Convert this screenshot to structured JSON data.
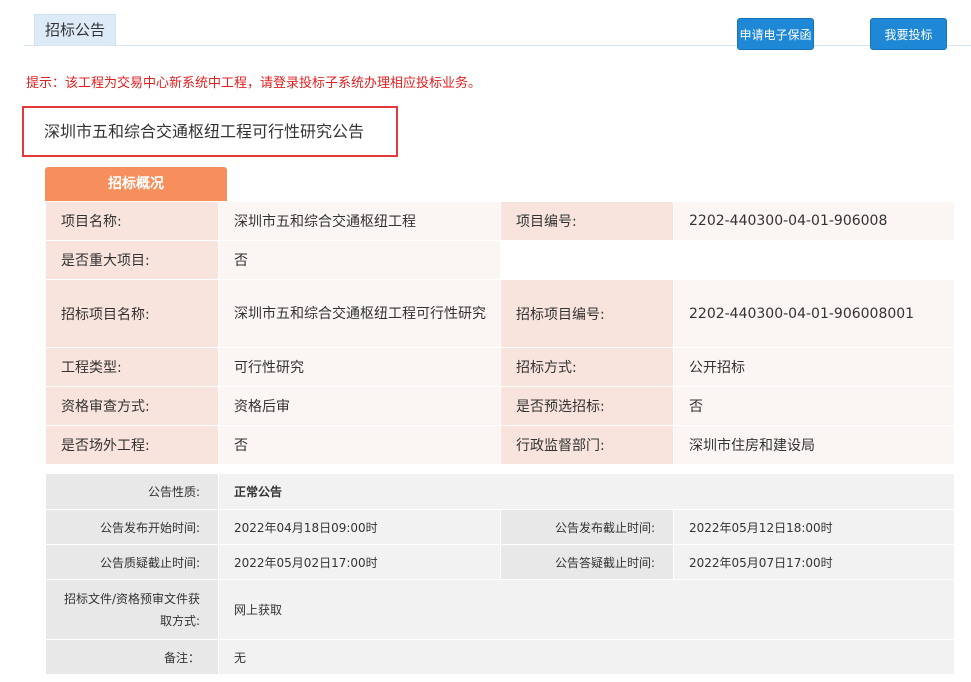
{
  "header": {
    "tab_label": "招标公告",
    "apply_guarantee_button": "申请电子保函",
    "bid_button": "我要投标"
  },
  "notice": "提示：该工程为交易中心新系统中工程，请登录投标子系统办理相应投标业务。",
  "project_title": "深圳市五和综合交通枢纽工程可行性研究公告",
  "overview": {
    "section_label": "招标概况",
    "project_name_label": "项目名称:",
    "project_name": "深圳市五和综合交通枢纽工程",
    "project_no_label": "项目编号:",
    "project_no": "2202-440300-04-01-906008",
    "major_label": "是否重大项目:",
    "major": "否",
    "bid_project_name_label": "招标项目名称:",
    "bid_project_name": "深圳市五和综合交通枢纽工程可行性研究",
    "bid_project_no_label": "招标项目编号:",
    "bid_project_no": "2202-440300-04-01-906008001",
    "eng_type_label": "工程类型:",
    "eng_type": "可行性研究",
    "bid_method_label": "招标方式:",
    "bid_method": "公开招标",
    "qual_review_label": "资格审查方式:",
    "qual_review": "资格后审",
    "preselect_label": "是否预选招标:",
    "preselect": "否",
    "offsite_label": "是否场外工程:",
    "offsite": "否",
    "supervisor_label": "行政监督部门:",
    "supervisor": "深圳市住房和建设局"
  },
  "announcement": {
    "nature_label": "公告性质:",
    "nature": "正常公告",
    "start_label": "公告发布开始时间:",
    "start": "2022年04月18日09:00时",
    "end_label": "公告发布截止时间:",
    "end": "2022年05月12日18:00时",
    "question_label": "公告质疑截止时间:",
    "question": "2022年05月02日17:00时",
    "answer_label": "公告答疑截止时间:",
    "answer": "2022年05月07日17:00时",
    "docs_label": "招标文件/资格预审文件获取方式:",
    "docs": "网上获取",
    "remark_label": "备注：",
    "remark": "无"
  }
}
